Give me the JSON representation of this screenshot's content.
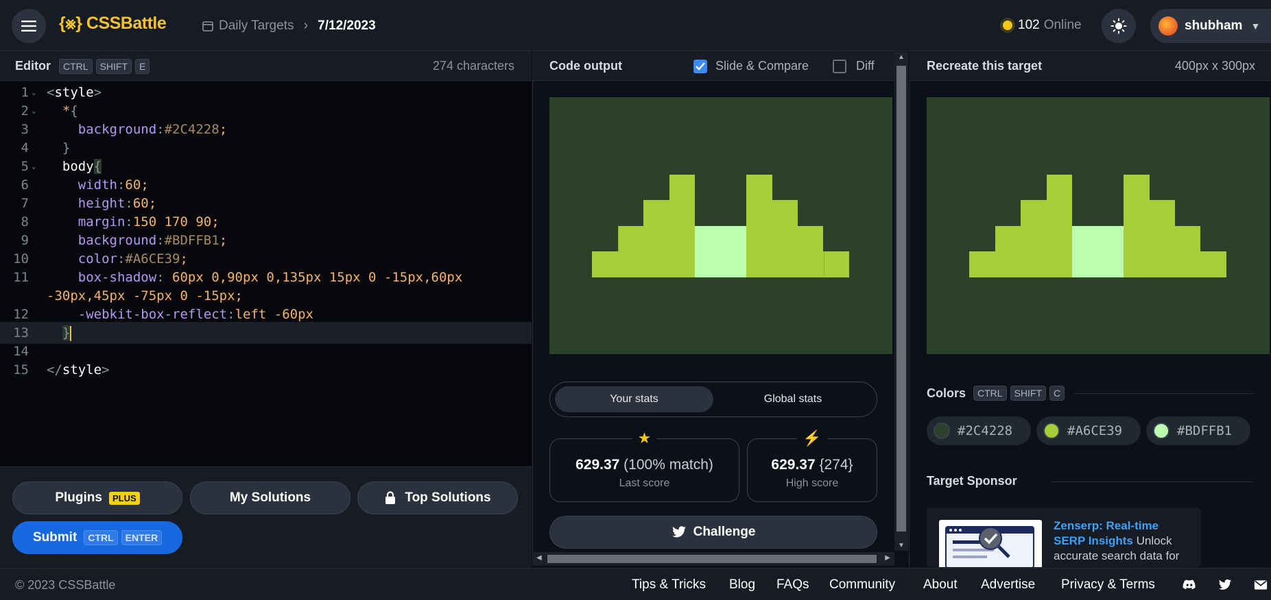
{
  "header": {
    "logo": "{⨳} CSSBattle",
    "breadcrumb": {
      "section": "Daily Targets",
      "date": "7/12/2023"
    },
    "online_count": "102",
    "online_label": "Online",
    "username": "shubham"
  },
  "editor": {
    "title": "Editor",
    "shortcut": [
      "CTRL",
      "SHIFT",
      "E"
    ],
    "char_count": "274 characters",
    "lines": [
      {
        "n": "1",
        "fold": "⌄"
      },
      {
        "n": "2",
        "fold": "⌄"
      },
      {
        "n": "3"
      },
      {
        "n": "4"
      },
      {
        "n": "5",
        "fold": "⌄"
      },
      {
        "n": "6"
      },
      {
        "n": "7"
      },
      {
        "n": "8"
      },
      {
        "n": "9"
      },
      {
        "n": "10"
      },
      {
        "n": "11"
      },
      {
        "n": "12"
      },
      {
        "n": "13"
      },
      {
        "n": "14"
      },
      {
        "n": "15"
      }
    ],
    "code": {
      "l1_tag": "style",
      "l2_sel": "*",
      "l3_prop": "background",
      "l3_val": "#2C4228",
      "l5_sel": "body",
      "l6_prop": "width",
      "l6_val": "60",
      "l7_prop": "height",
      "l7_val": "60",
      "l8_prop": "margin",
      "l8_val": "150 170 90",
      "l9_prop": "background",
      "l9_val": "#BDFFB1",
      "l10_prop": "color",
      "l10_val": "#A6CE39",
      "l11_prop": "box-shadow",
      "l11_a": " 60px 0,90px 0,135px 15px 0 -15px,60px",
      "l11_b": "-30px,45px -75px 0 -15px",
      "l12_prop": "-webkit-box-reflect",
      "l12_val": "left -60px",
      "l15_tag": "style"
    }
  },
  "buttons": {
    "plugins": "Plugins",
    "plus_badge": "PLUS",
    "my_solutions": "My Solutions",
    "top_solutions": "Top Solutions",
    "submit": "Submit",
    "submit_keys": [
      "CTRL",
      "ENTER"
    ]
  },
  "output": {
    "title": "Code output",
    "slide_compare": "Slide & Compare",
    "slide_compare_checked": true,
    "diff": "Diff",
    "diff_checked": false
  },
  "stats": {
    "tab_yours": "Your stats",
    "tab_global": "Global stats",
    "last_score_value": "629.37",
    "last_score_detail": "(100% match)",
    "last_score_label": "Last score",
    "high_score_value": "629.37",
    "high_score_detail": "{274}",
    "high_score_label": "High score",
    "challenge": "Challenge"
  },
  "target": {
    "title": "Recreate this target",
    "size": "400px x 300px",
    "colors_title": "Colors",
    "colors_shortcut": [
      "CTRL",
      "SHIFT",
      "C"
    ],
    "colors": [
      {
        "hex": "#2C4228",
        "swatch": "#2c4228"
      },
      {
        "hex": "#A6CE39",
        "swatch": "#a6ce39"
      },
      {
        "hex": "#BDFFB1",
        "swatch": "#bdffb1"
      }
    ],
    "sponsor_title": "Target Sponsor",
    "sponsor_name": "Zenserp: Real-time SERP Insights",
    "sponsor_text": "Unlock accurate search data for"
  },
  "footer": {
    "copyright": "© 2023 CSSBattle",
    "links": [
      "Tips & Tricks",
      "Blog",
      "FAQs",
      "Community",
      "About",
      "Advertise",
      "Privacy & Terms"
    ],
    "social_icons": [
      "discord-icon",
      "twitter-icon",
      "mail-icon"
    ]
  }
}
